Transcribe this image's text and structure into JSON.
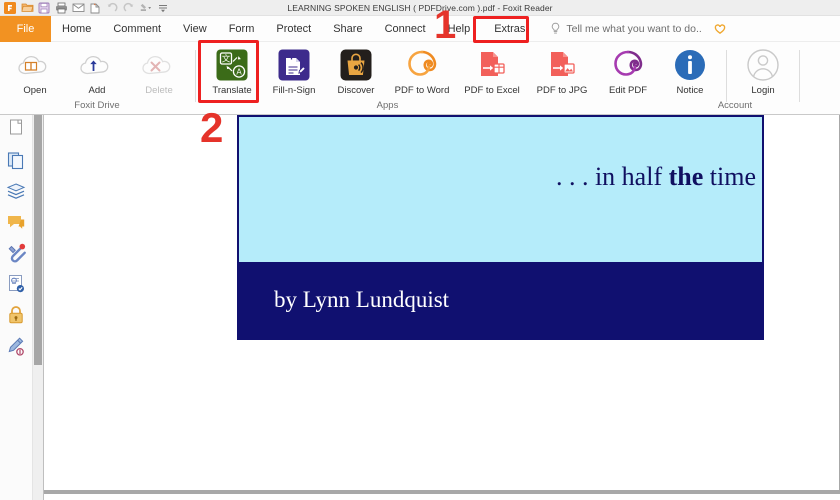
{
  "window": {
    "title": "LEARNING SPOKEN ENGLISH ( PDFDrive.com ).pdf - Foxit Reader",
    "accent_orange": "#f29222",
    "annotation_red": "#ee2020"
  },
  "quick_access": [
    {
      "name": "foxit-logo-icon",
      "label": "Foxit"
    },
    {
      "name": "open-file-icon",
      "label": "Open"
    },
    {
      "name": "save-icon",
      "label": "Save"
    },
    {
      "name": "print-icon",
      "label": "Print"
    },
    {
      "name": "email-icon",
      "label": "Email"
    },
    {
      "name": "create-pdf-icon",
      "label": "Create PDF"
    },
    {
      "name": "undo-icon",
      "label": "Undo"
    },
    {
      "name": "redo-icon",
      "label": "Redo"
    },
    {
      "name": "highlight-dropdown-icon",
      "label": "Highlight"
    },
    {
      "name": "customize-toolbar-icon",
      "label": "Customize"
    }
  ],
  "tabs": [
    {
      "label": "File",
      "active": false,
      "kind": "file"
    },
    {
      "label": "Home",
      "active": false,
      "kind": "normal"
    },
    {
      "label": "Comment",
      "active": false,
      "kind": "normal"
    },
    {
      "label": "View",
      "active": false,
      "kind": "normal"
    },
    {
      "label": "Form",
      "active": false,
      "kind": "normal"
    },
    {
      "label": "Protect",
      "active": false,
      "kind": "normal"
    },
    {
      "label": "Share",
      "active": false,
      "kind": "normal"
    },
    {
      "label": "Connect",
      "active": false,
      "kind": "normal"
    },
    {
      "label": "Help",
      "active": false,
      "kind": "normal"
    },
    {
      "label": "Extras",
      "active": true,
      "kind": "normal"
    }
  ],
  "search": {
    "placeholder": "Tell me what you want to do..",
    "text": "Tell me what you want to do..",
    "icon": "lightbulb-icon",
    "trailing_icon": "heart-icon"
  },
  "ribbon": {
    "groups": [
      {
        "caption": "Foxit Drive",
        "items": [
          {
            "label": "Open",
            "icon": "cloud-open-book-icon",
            "disabled": false
          },
          {
            "label": "Add",
            "icon": "cloud-upload-icon",
            "disabled": false
          },
          {
            "label": "Delete",
            "icon": "cloud-delete-icon",
            "disabled": true
          }
        ]
      },
      {
        "caption": "Apps",
        "items": [
          {
            "label": "Translate",
            "icon": "translate-icon",
            "disabled": false
          },
          {
            "label": "Fill-n-Sign",
            "icon": "fill-sign-icon",
            "disabled": false
          },
          {
            "label": "Discover",
            "icon": "discover-bag-icon",
            "disabled": false
          },
          {
            "label": "PDF to Word",
            "icon": "pdf-to-word-icon",
            "disabled": false
          },
          {
            "label": "PDF to Excel",
            "icon": "pdf-to-excel-icon",
            "disabled": false
          },
          {
            "label": "PDF to JPG",
            "icon": "pdf-to-jpg-icon",
            "disabled": false
          },
          {
            "label": "Edit PDF",
            "icon": "edit-pdf-icon",
            "disabled": false
          },
          {
            "label": "Notice",
            "icon": "notice-info-icon",
            "disabled": false
          }
        ]
      },
      {
        "caption": "Account",
        "items": [
          {
            "label": "Login",
            "icon": "user-account-icon",
            "disabled": false
          }
        ]
      }
    ]
  },
  "annotations": {
    "step1": {
      "label": "1",
      "target": "Extras"
    },
    "step2": {
      "label": "2",
      "target": "Translate"
    }
  },
  "sidebar": {
    "items": [
      {
        "name": "page-thumbnails-icon",
        "label": "Page Thumbnails"
      },
      {
        "name": "bookmarks-icon",
        "label": "Bookmarks"
      },
      {
        "name": "layers-icon",
        "label": "Layers"
      },
      {
        "name": "comments-icon",
        "label": "Comments"
      },
      {
        "name": "attachments-icon",
        "label": "Attachments"
      },
      {
        "name": "stamps-icon",
        "label": "Stamps"
      },
      {
        "name": "security-lock-icon",
        "label": "Security"
      },
      {
        "name": "signature-icon",
        "label": "Digital Signatures"
      }
    ]
  },
  "document": {
    "cover": {
      "tagline_prefix": ". . . in half ",
      "tagline_bold": "the",
      "tagline_suffix": " time",
      "author": "by Lynn Lundquist",
      "top_color": "#b5ecfa",
      "bottom_color": "#101070"
    }
  }
}
